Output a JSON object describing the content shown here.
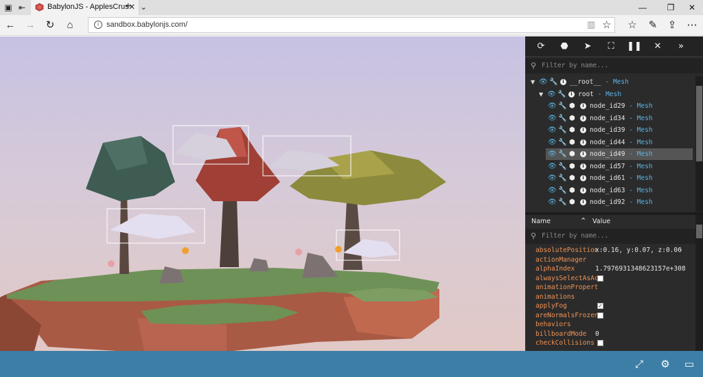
{
  "browser": {
    "tab_title": "BabylonJS - ApplesCrus",
    "new_tab": "+",
    "tab_list": "⌄",
    "url": "sandbox.babylonjs.com/",
    "icons": {
      "tab_actions": "tab-actions-icon",
      "tab_switch": "set-aside-tabs-icon",
      "back": "back-arrow-icon",
      "forward": "forward-arrow-icon",
      "refresh": "refresh-icon",
      "home": "home-icon",
      "reading_view": "reading-view-icon",
      "favorite": "star-icon",
      "favorites_hub": "favorites-list-icon",
      "notes": "pen-icon",
      "share": "share-icon",
      "more": "more-icon"
    }
  },
  "inspector": {
    "filter_placeholder": "Filter by name...",
    "tree": [
      {
        "name": "__root__",
        "type": "Mesh",
        "level": 0,
        "arrow": true
      },
      {
        "name": "root",
        "type": "Mesh",
        "level": 1,
        "arrow": true
      },
      {
        "name": "node_id29",
        "type": "Mesh",
        "level": 2
      },
      {
        "name": "node_id34",
        "type": "Mesh",
        "level": 2
      },
      {
        "name": "node_id39",
        "type": "Mesh",
        "level": 2
      },
      {
        "name": "node_id44",
        "type": "Mesh",
        "level": 2
      },
      {
        "name": "node_id49",
        "type": "Mesh",
        "level": 2,
        "selected": true
      },
      {
        "name": "node_id57",
        "type": "Mesh",
        "level": 2
      },
      {
        "name": "node_id61",
        "type": "Mesh",
        "level": 2
      },
      {
        "name": "node_id63",
        "type": "Mesh",
        "level": 2
      },
      {
        "name": "node_id92",
        "type": "Mesh",
        "level": 2
      }
    ],
    "prop_header": {
      "name": "Name",
      "value": "Value"
    },
    "prop_filter_placeholder": "Filter by name...",
    "properties": [
      {
        "name": "absolutePosition",
        "value": "x:0.16, y:0.07, z:0.06",
        "expandable": true
      },
      {
        "name": "actionManager",
        "value": ""
      },
      {
        "name": "alphaIndex",
        "value": "1.7976931348623157e+308"
      },
      {
        "name": "alwaysSelectAsAc…",
        "checkbox": true,
        "checked": false
      },
      {
        "name": "animationPropert…",
        "value": ""
      },
      {
        "name": "animations",
        "value": ""
      },
      {
        "name": "applyFog",
        "checkbox": true,
        "checked": true
      },
      {
        "name": "areNormalsFrozen",
        "checkbox": true,
        "checked": false
      },
      {
        "name": "behaviors",
        "value": ""
      },
      {
        "name": "billboardMode",
        "value": "0"
      },
      {
        "name": "checkCollisions",
        "checkbox": true,
        "checked": false
      }
    ],
    "colors": {
      "accent": "#5bb4e5",
      "prop_name": "#f09255",
      "panel_bg": "#2b2b2b"
    }
  },
  "footer": {
    "color": "#3d7ea6",
    "icons": [
      "fullscreen-icon",
      "inspector-toggle-icon",
      "open-file-icon"
    ]
  }
}
